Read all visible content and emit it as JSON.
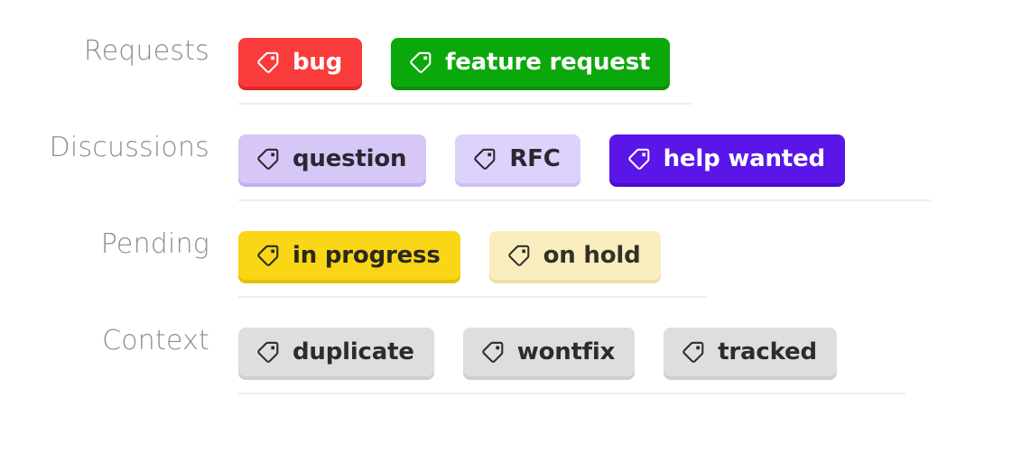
{
  "rows": [
    {
      "label": "Requests",
      "divider_width": 502,
      "chips": [
        {
          "text": "bug",
          "bg": "#f93b3b",
          "edge": "#e02a2a",
          "fg": "#ffffff",
          "icon": "tag-icon"
        },
        {
          "text": "feature request",
          "bg": "#0ba80b",
          "edge": "#0a8f0a",
          "fg": "#ffffff",
          "icon": "tag-icon"
        }
      ]
    },
    {
      "label": "Discussions",
      "divider_width": 767,
      "chips": [
        {
          "text": "question",
          "bg": "#d6c7f7",
          "edge": "#c3b0ee",
          "fg": "#2b2730",
          "icon": "tag-icon"
        },
        {
          "text": "RFC",
          "bg": "#ddd2fb",
          "edge": "#cec0f3",
          "fg": "#2b2730",
          "icon": "tag-icon"
        },
        {
          "text": "help wanted",
          "bg": "#5a16e8",
          "edge": "#4b0fcb",
          "fg": "#ffffff",
          "icon": "tag-icon"
        }
      ]
    },
    {
      "label": "Pending",
      "divider_width": 519,
      "chips": [
        {
          "text": "in progress",
          "bg": "#f9d616",
          "edge": "#e6bf06",
          "fg": "#2b2720",
          "icon": "tag-icon"
        },
        {
          "text": "on hold",
          "bg": "#faeebf",
          "edge": "#efe0a9",
          "fg": "#33302a",
          "icon": "tag-icon"
        }
      ]
    },
    {
      "label": "Context",
      "divider_width": 739,
      "chips": [
        {
          "text": "duplicate",
          "bg": "#dedede",
          "edge": "#cfcfcf",
          "fg": "#2c2c2c",
          "icon": "tag-icon"
        },
        {
          "text": "wontfix",
          "bg": "#dedede",
          "edge": "#cfcfcf",
          "fg": "#2c2c2c",
          "icon": "tag-icon"
        },
        {
          "text": "tracked",
          "bg": "#dedede",
          "edge": "#cfcfcf",
          "fg": "#2c2c2c",
          "icon": "tag-icon"
        }
      ]
    }
  ],
  "theme": {
    "background": "#ffffff",
    "label_color": "#8d8d8d",
    "divider_color": "#eeeeee"
  }
}
